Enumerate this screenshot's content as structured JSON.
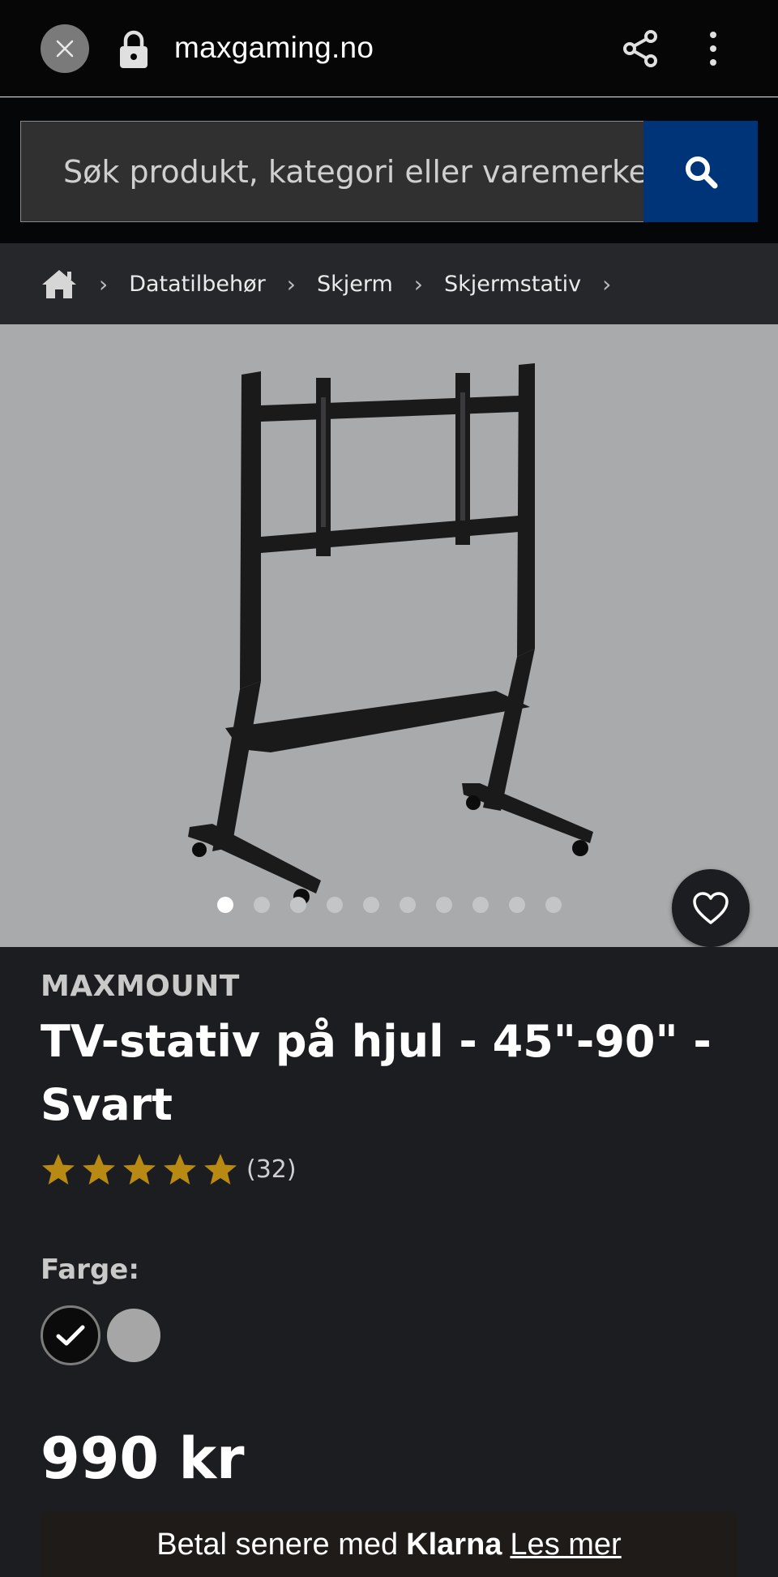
{
  "browser": {
    "url": "maxgaming.no",
    "icons": [
      "close-icon",
      "lock-icon",
      "share-icon",
      "more-vertical-icon"
    ]
  },
  "search": {
    "placeholder": "Søk produkt, kategori eller varemerke"
  },
  "breadcrumb": {
    "items": [
      "Datatilbehør",
      "Skjerm",
      "Skjermstativ"
    ]
  },
  "gallery": {
    "image_count": 10,
    "active_index": 0
  },
  "product": {
    "brand": "MAXMOUNT",
    "title": "TV-stativ på hjul - 45\"-90\" - Svart",
    "rating": 5,
    "rating_count": "(32)",
    "color_label": "Farge:",
    "colors": [
      "#0b0b0c",
      "#a6a6a6"
    ],
    "selected_color": 0,
    "price": "990 kr"
  },
  "klarna": {
    "prefix": "Betal senere med",
    "brand": "Klarna",
    "link": "Les mer"
  },
  "colors": {
    "accent_blue": "#003479",
    "star_gold": "#b88a14",
    "background": "#1c1d20"
  }
}
